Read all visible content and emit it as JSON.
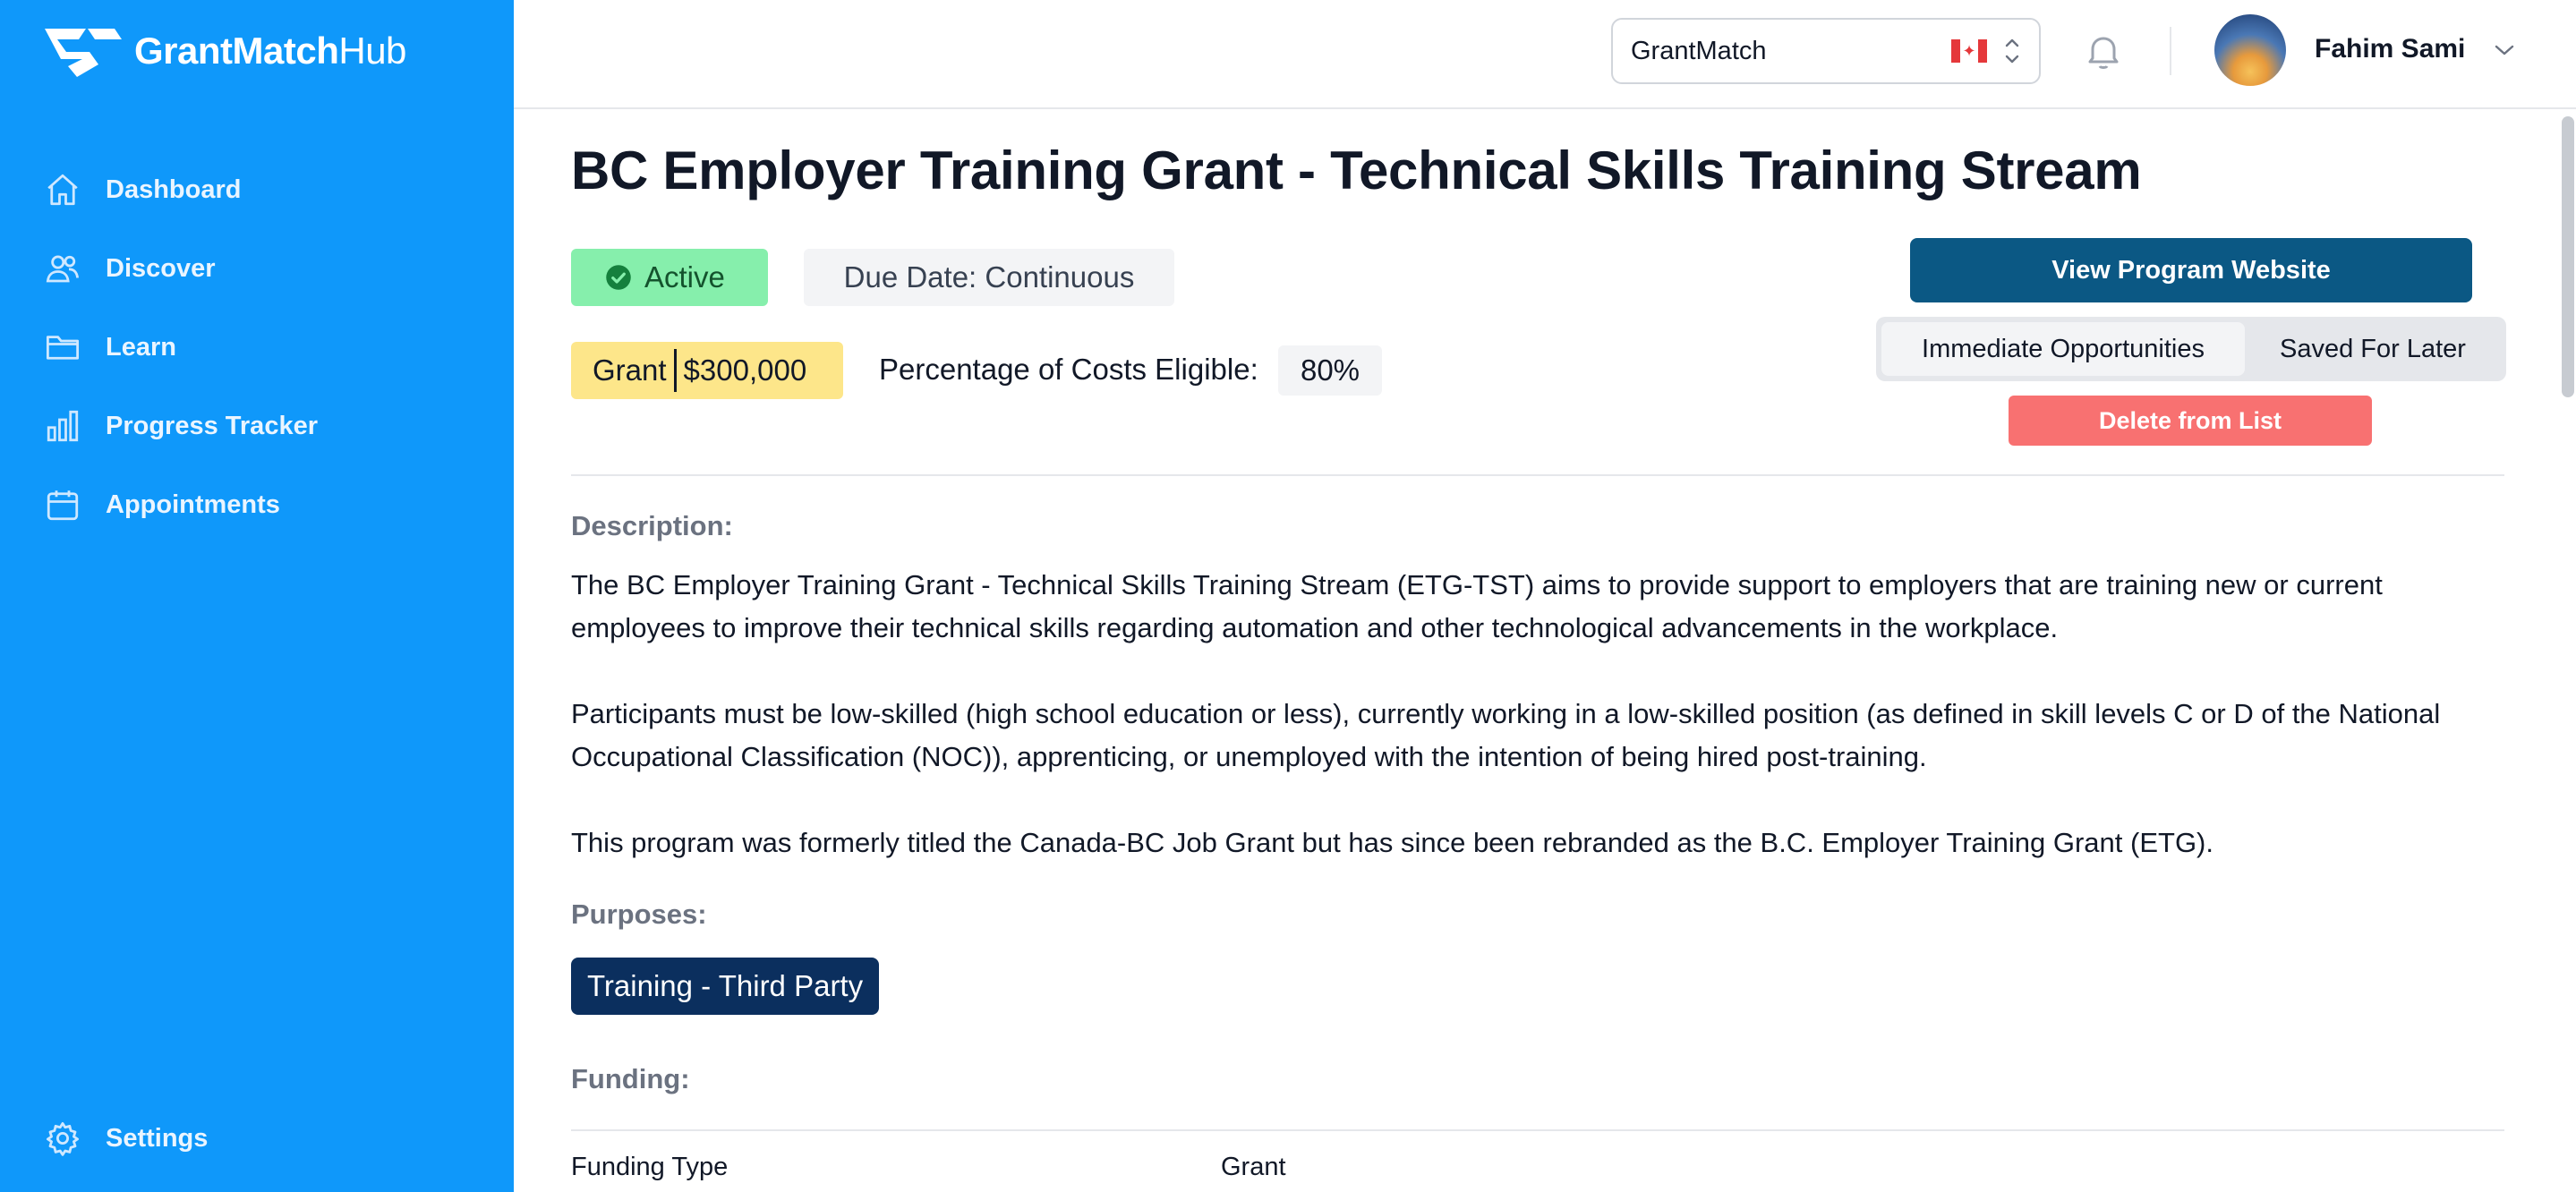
{
  "brand": {
    "name_bold": "GrantMatch",
    "name_light": "Hub"
  },
  "sidebar": {
    "items": [
      {
        "label": "Dashboard",
        "icon": "home-icon"
      },
      {
        "label": "Discover",
        "icon": "users-icon"
      },
      {
        "label": "Learn",
        "icon": "folder-icon"
      },
      {
        "label": "Progress Tracker",
        "icon": "bar-chart-icon"
      },
      {
        "label": "Appointments",
        "icon": "calendar-icon"
      }
    ],
    "settings_label": "Settings"
  },
  "topbar": {
    "org_select_value": "GrantMatch",
    "user_name": "Fahim Sami"
  },
  "grant": {
    "title": "BC Employer Training Grant - Technical Skills Training Stream",
    "status": "Active",
    "due_date": "Due Date: Continuous",
    "type": "Grant",
    "amount": "$300,000",
    "pct_label": "Percentage of Costs Eligible:",
    "pct_value": "80%"
  },
  "actions": {
    "website_label": "View Program Website",
    "tab_immediate": "Immediate Opportunities",
    "tab_saved": "Saved For Later",
    "delete_label": "Delete from List"
  },
  "description": {
    "label": "Description:",
    "p1": "The BC Employer Training Grant - Technical Skills Training Stream (ETG-TST) aims to provide support to employers that are training new or current employees to improve their technical skills regarding automation and other technological advancements in the workplace.",
    "p2": "Participants must be low-skilled (high school education or less), currently working in a low-skilled position (as defined in skill levels C or D of the National Occupational Classification (NOC)), apprenticing, or unemployed with the intention of being hired post-training.",
    "p3": "This program was formerly titled the Canada-BC Job Grant but has since been rebranded as the B.C. Employer Training Grant (ETG)."
  },
  "purposes": {
    "label": "Purposes:",
    "tags": [
      "Training - Third Party"
    ]
  },
  "funding": {
    "label": "Funding:",
    "rows": [
      {
        "key": "Funding Type",
        "value": "Grant"
      }
    ]
  },
  "colors": {
    "sidebar": "#0f98fa",
    "primary_button": "#0b5884",
    "delete_button": "#f87171",
    "active_badge": "#86efac",
    "grant_badge": "#fde68a",
    "purpose_tag": "#0b2f5e"
  }
}
